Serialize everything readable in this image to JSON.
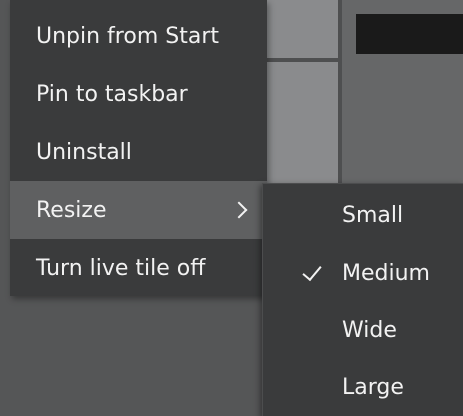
{
  "context_menu": {
    "items": [
      {
        "label": "Unpin from Start"
      },
      {
        "label": "Pin to taskbar"
      },
      {
        "label": "Uninstall"
      },
      {
        "label": "Resize",
        "has_submenu": true,
        "highlighted": true
      },
      {
        "label": "Turn live tile off"
      }
    ]
  },
  "resize_submenu": {
    "items": [
      {
        "label": "Small",
        "checked": false
      },
      {
        "label": "Medium",
        "checked": true
      },
      {
        "label": "Wide",
        "checked": false
      },
      {
        "label": "Large",
        "checked": false
      }
    ]
  },
  "colors": {
    "menu_background": "#3a3b3c",
    "highlight": "#5f6061",
    "text": "#f2f2f2",
    "tile": "#8a8b8d"
  },
  "icons": {
    "submenu_arrow": "chevron-right-icon",
    "selected_mark": "checkmark-icon"
  }
}
